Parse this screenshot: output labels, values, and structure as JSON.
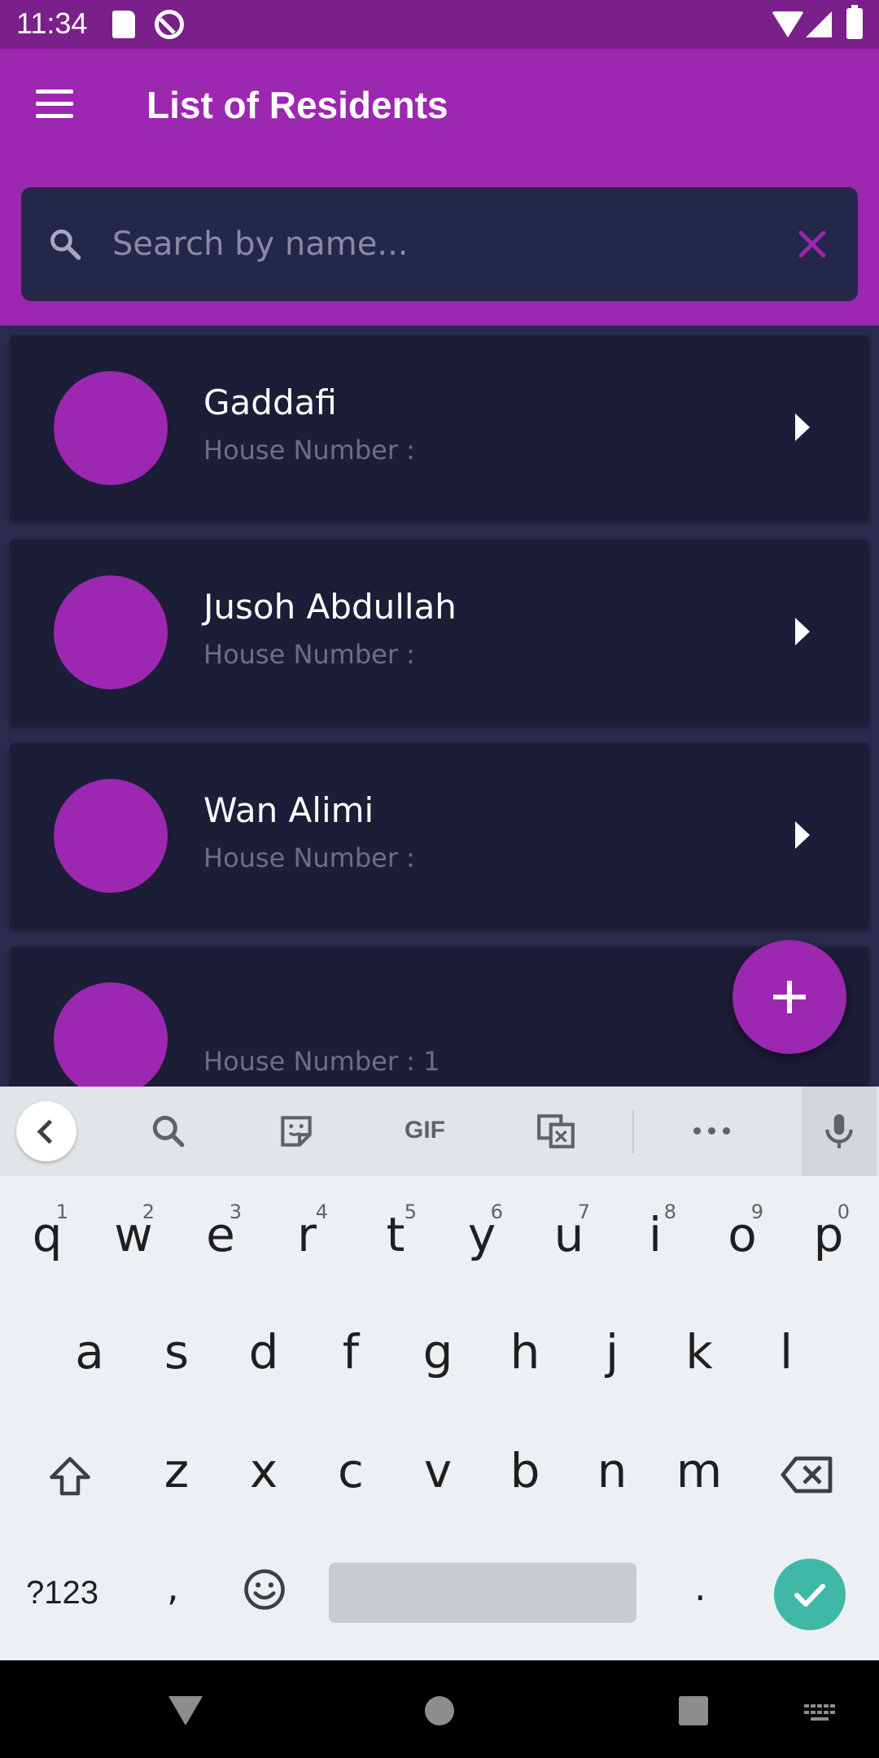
{
  "status_bar": {
    "time": "11:34"
  },
  "app_bar": {
    "title": "List of Residents"
  },
  "search": {
    "placeholder": "Search by name...",
    "value": ""
  },
  "residents": [
    {
      "name": "Gaddafi",
      "house_label": "House Number :"
    },
    {
      "name": "Jusoh Abdullah",
      "house_label": "House Number :"
    },
    {
      "name": "Wan Alimi",
      "house_label": "House Number :"
    },
    {
      "name": "",
      "house_label": "House Number : 1"
    }
  ],
  "colors": {
    "accent": "#9c27b0",
    "status_bar": "#7b1f8a",
    "background": "#2a2b4d",
    "card": "#1c1d37",
    "enter_key": "#3fb8a8"
  },
  "keyboard": {
    "toolbar": {
      "icons": [
        "back-icon",
        "search-icon",
        "sticker-icon",
        "translate-icon",
        "more-icon",
        "mic-icon"
      ],
      "gif_label": "GIF"
    },
    "row1": [
      {
        "k": "q",
        "h": "1"
      },
      {
        "k": "w",
        "h": "2"
      },
      {
        "k": "e",
        "h": "3"
      },
      {
        "k": "r",
        "h": "4"
      },
      {
        "k": "t",
        "h": "5"
      },
      {
        "k": "y",
        "h": "6"
      },
      {
        "k": "u",
        "h": "7"
      },
      {
        "k": "i",
        "h": "8"
      },
      {
        "k": "o",
        "h": "9"
      },
      {
        "k": "p",
        "h": "0"
      }
    ],
    "row2": [
      "a",
      "s",
      "d",
      "f",
      "g",
      "h",
      "j",
      "k",
      "l"
    ],
    "row3": [
      "z",
      "x",
      "c",
      "v",
      "b",
      "n",
      "m"
    ],
    "symbols_label": "?123",
    "comma": ",",
    "period": "."
  }
}
